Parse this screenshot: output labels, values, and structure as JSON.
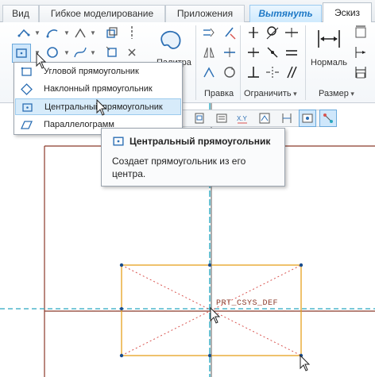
{
  "tabs": [
    {
      "label": "Вид"
    },
    {
      "label": "Гибкое моделирование"
    },
    {
      "label": "Приложения"
    },
    {
      "label": "Вытянуть"
    },
    {
      "label": "Эскиз"
    }
  ],
  "ribbon": {
    "palette_label": "Палитра",
    "normal_label": "Нормаль",
    "groups": {
      "edit": "Правка",
      "constrain": "Ограничить",
      "dimension": "Размер"
    }
  },
  "menu": {
    "items": [
      {
        "label": "Угловой прямоугольник",
        "icon": "corner-rectangle-icon"
      },
      {
        "label": "Наклонный прямоугольник",
        "icon": "slanted-rectangle-icon"
      },
      {
        "label": "Центральный прямоугольник",
        "icon": "center-rectangle-icon",
        "highlighted": true
      },
      {
        "label": "Параллелограмм",
        "icon": "parallelogram-icon"
      }
    ]
  },
  "tooltip": {
    "title": "Центральный прямоугольник",
    "body": "Создает прямоугольник из его центра."
  },
  "graphics": {
    "csys_label": "PRT_CSYS_DEF"
  },
  "colors": {
    "accent": "#1d78c6",
    "sketch_line": "#e6a21e",
    "construction": "#d9534f",
    "datum_plane": "#8b3a2a",
    "axis": "#2aa7c0",
    "vertex": "#1a4c8c"
  }
}
